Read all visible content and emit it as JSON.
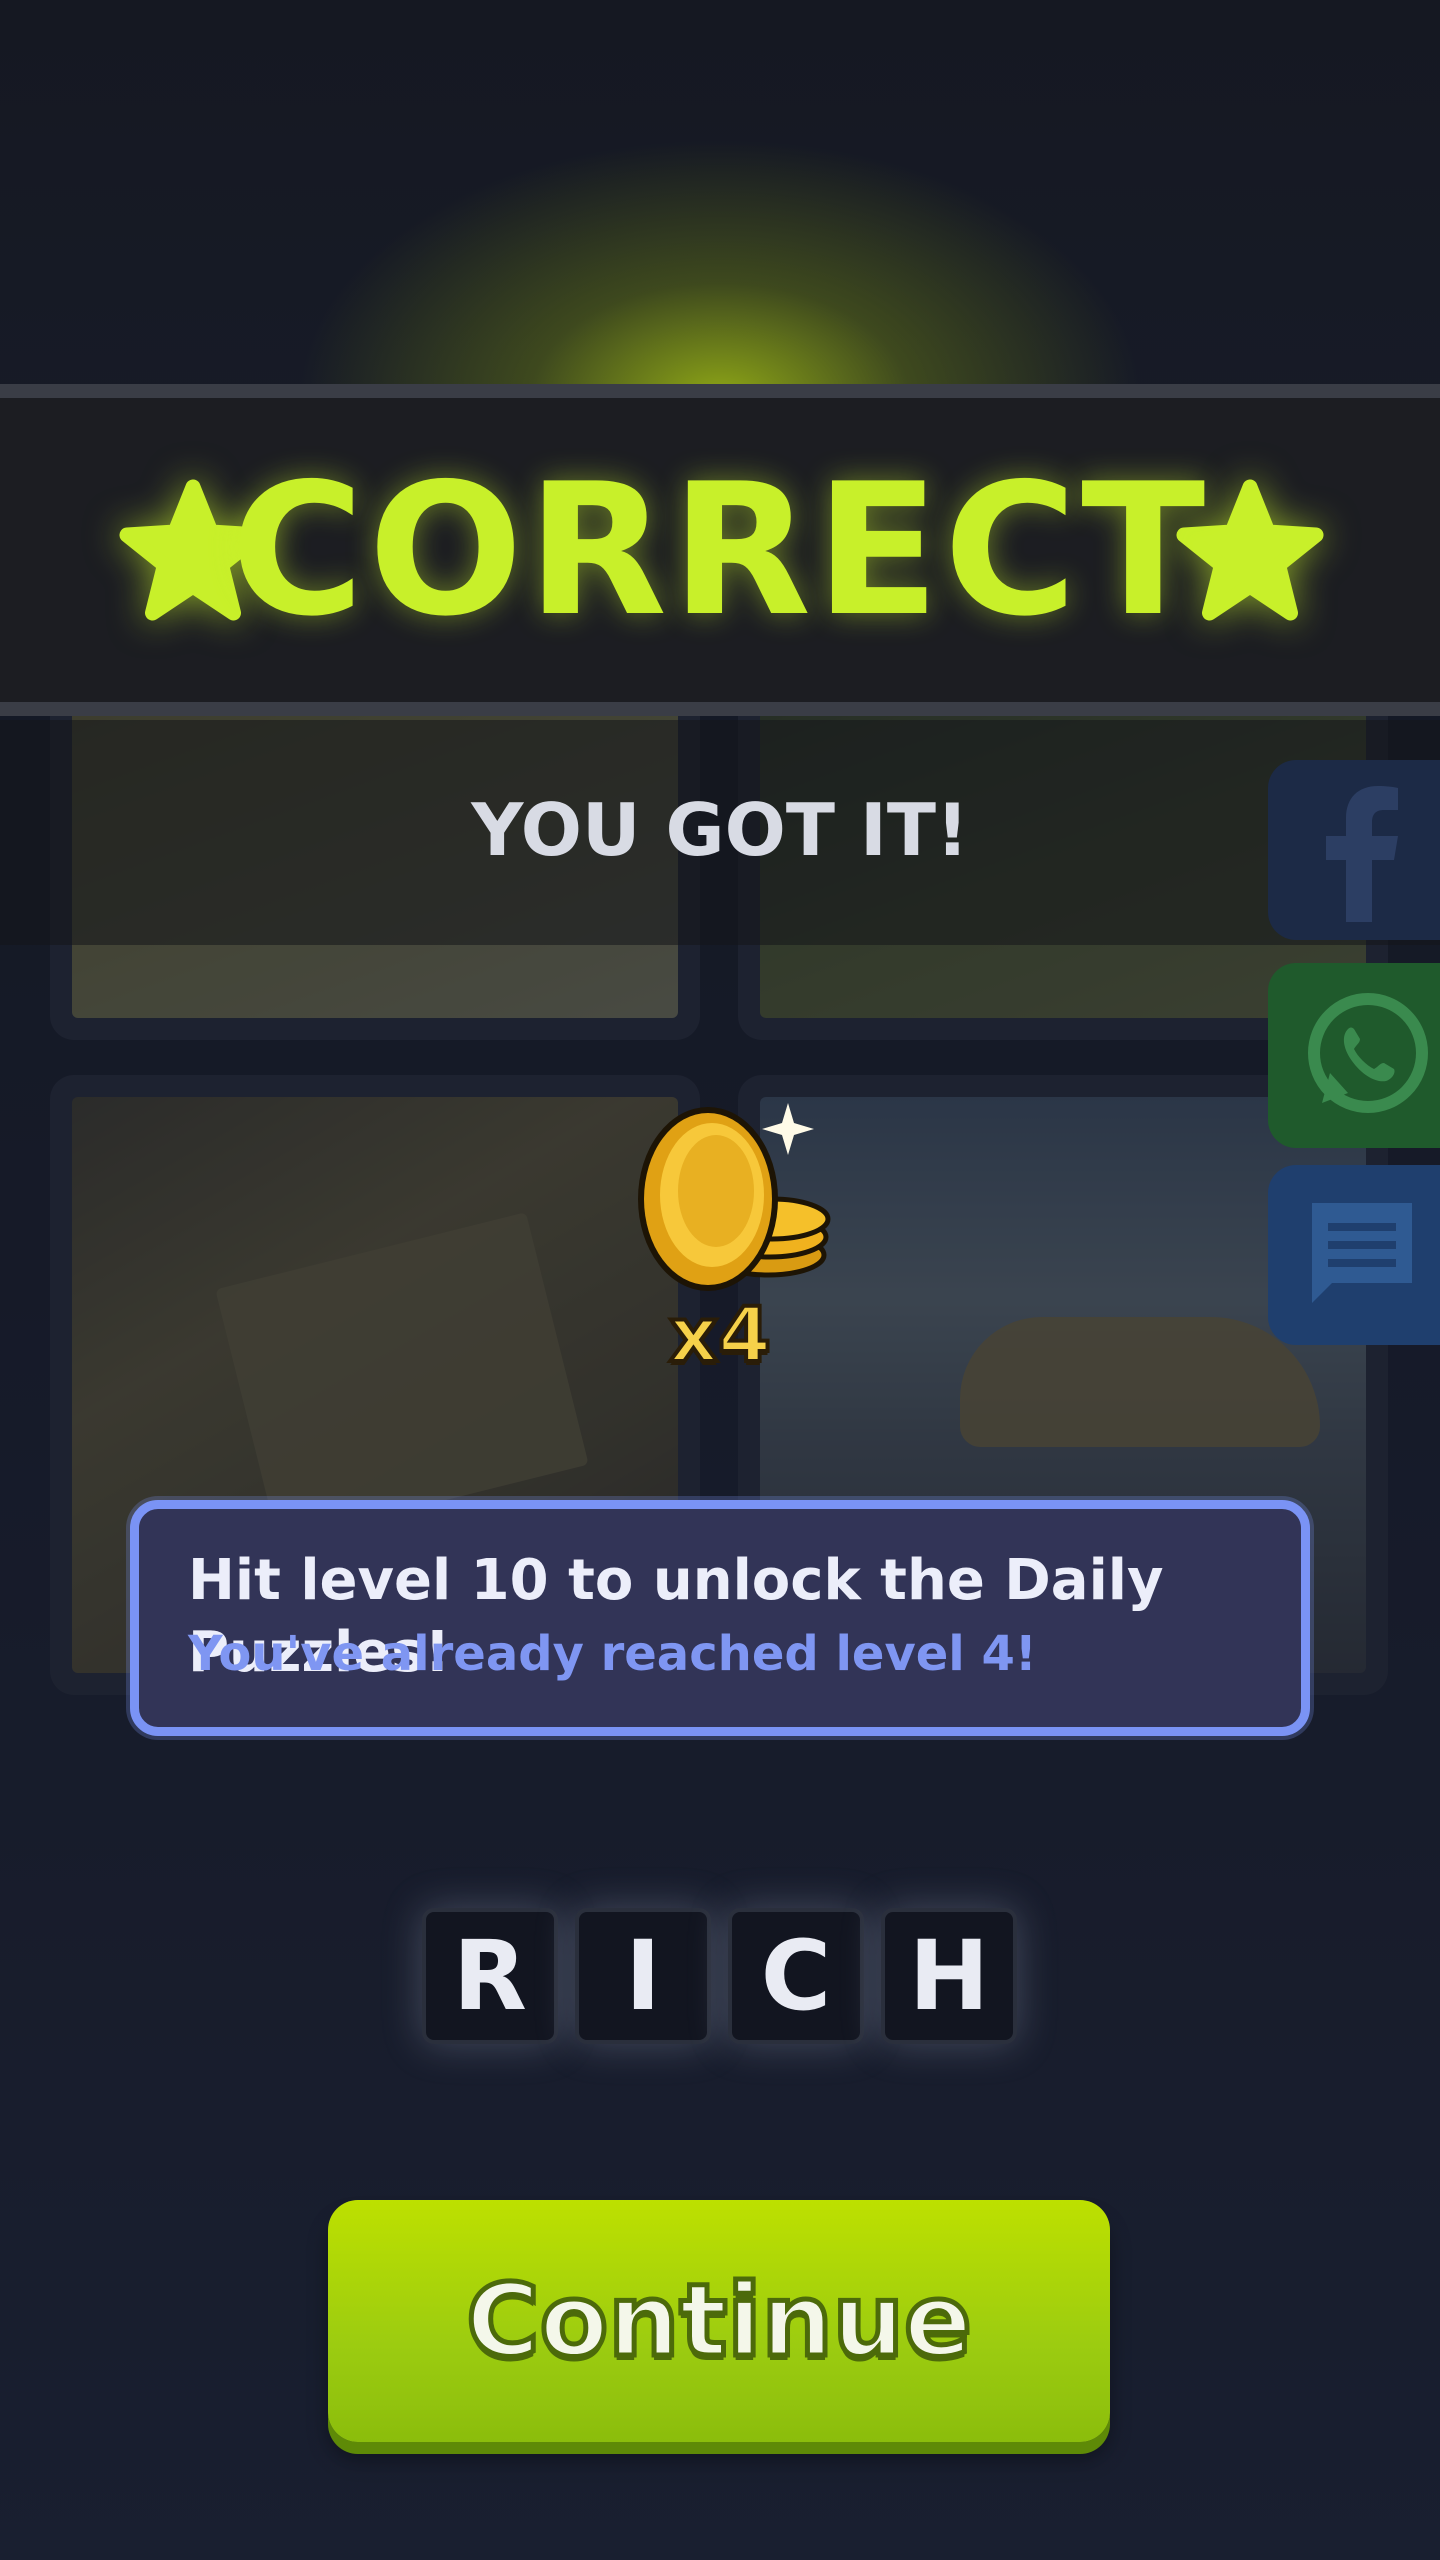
{
  "banner": {
    "title": "CORRECT",
    "subtitle": "YOU GOT IT!"
  },
  "reward": {
    "multiplier": "x4",
    "icon": "coin-stack-icon"
  },
  "info": {
    "line1": "Hit level 10 to unlock the Daily Puzzles!",
    "line2": "You've already reached level 4!"
  },
  "answer": {
    "letters": [
      "R",
      "I",
      "C",
      "H"
    ]
  },
  "share": {
    "icons": [
      "facebook-icon",
      "whatsapp-icon",
      "message-icon"
    ]
  },
  "button": {
    "continue_label": "Continue"
  },
  "colors": {
    "accent": "#c8f02a",
    "info_border": "#7a93f5",
    "info_text": "#7f96f2",
    "button": "#a5d40a"
  }
}
